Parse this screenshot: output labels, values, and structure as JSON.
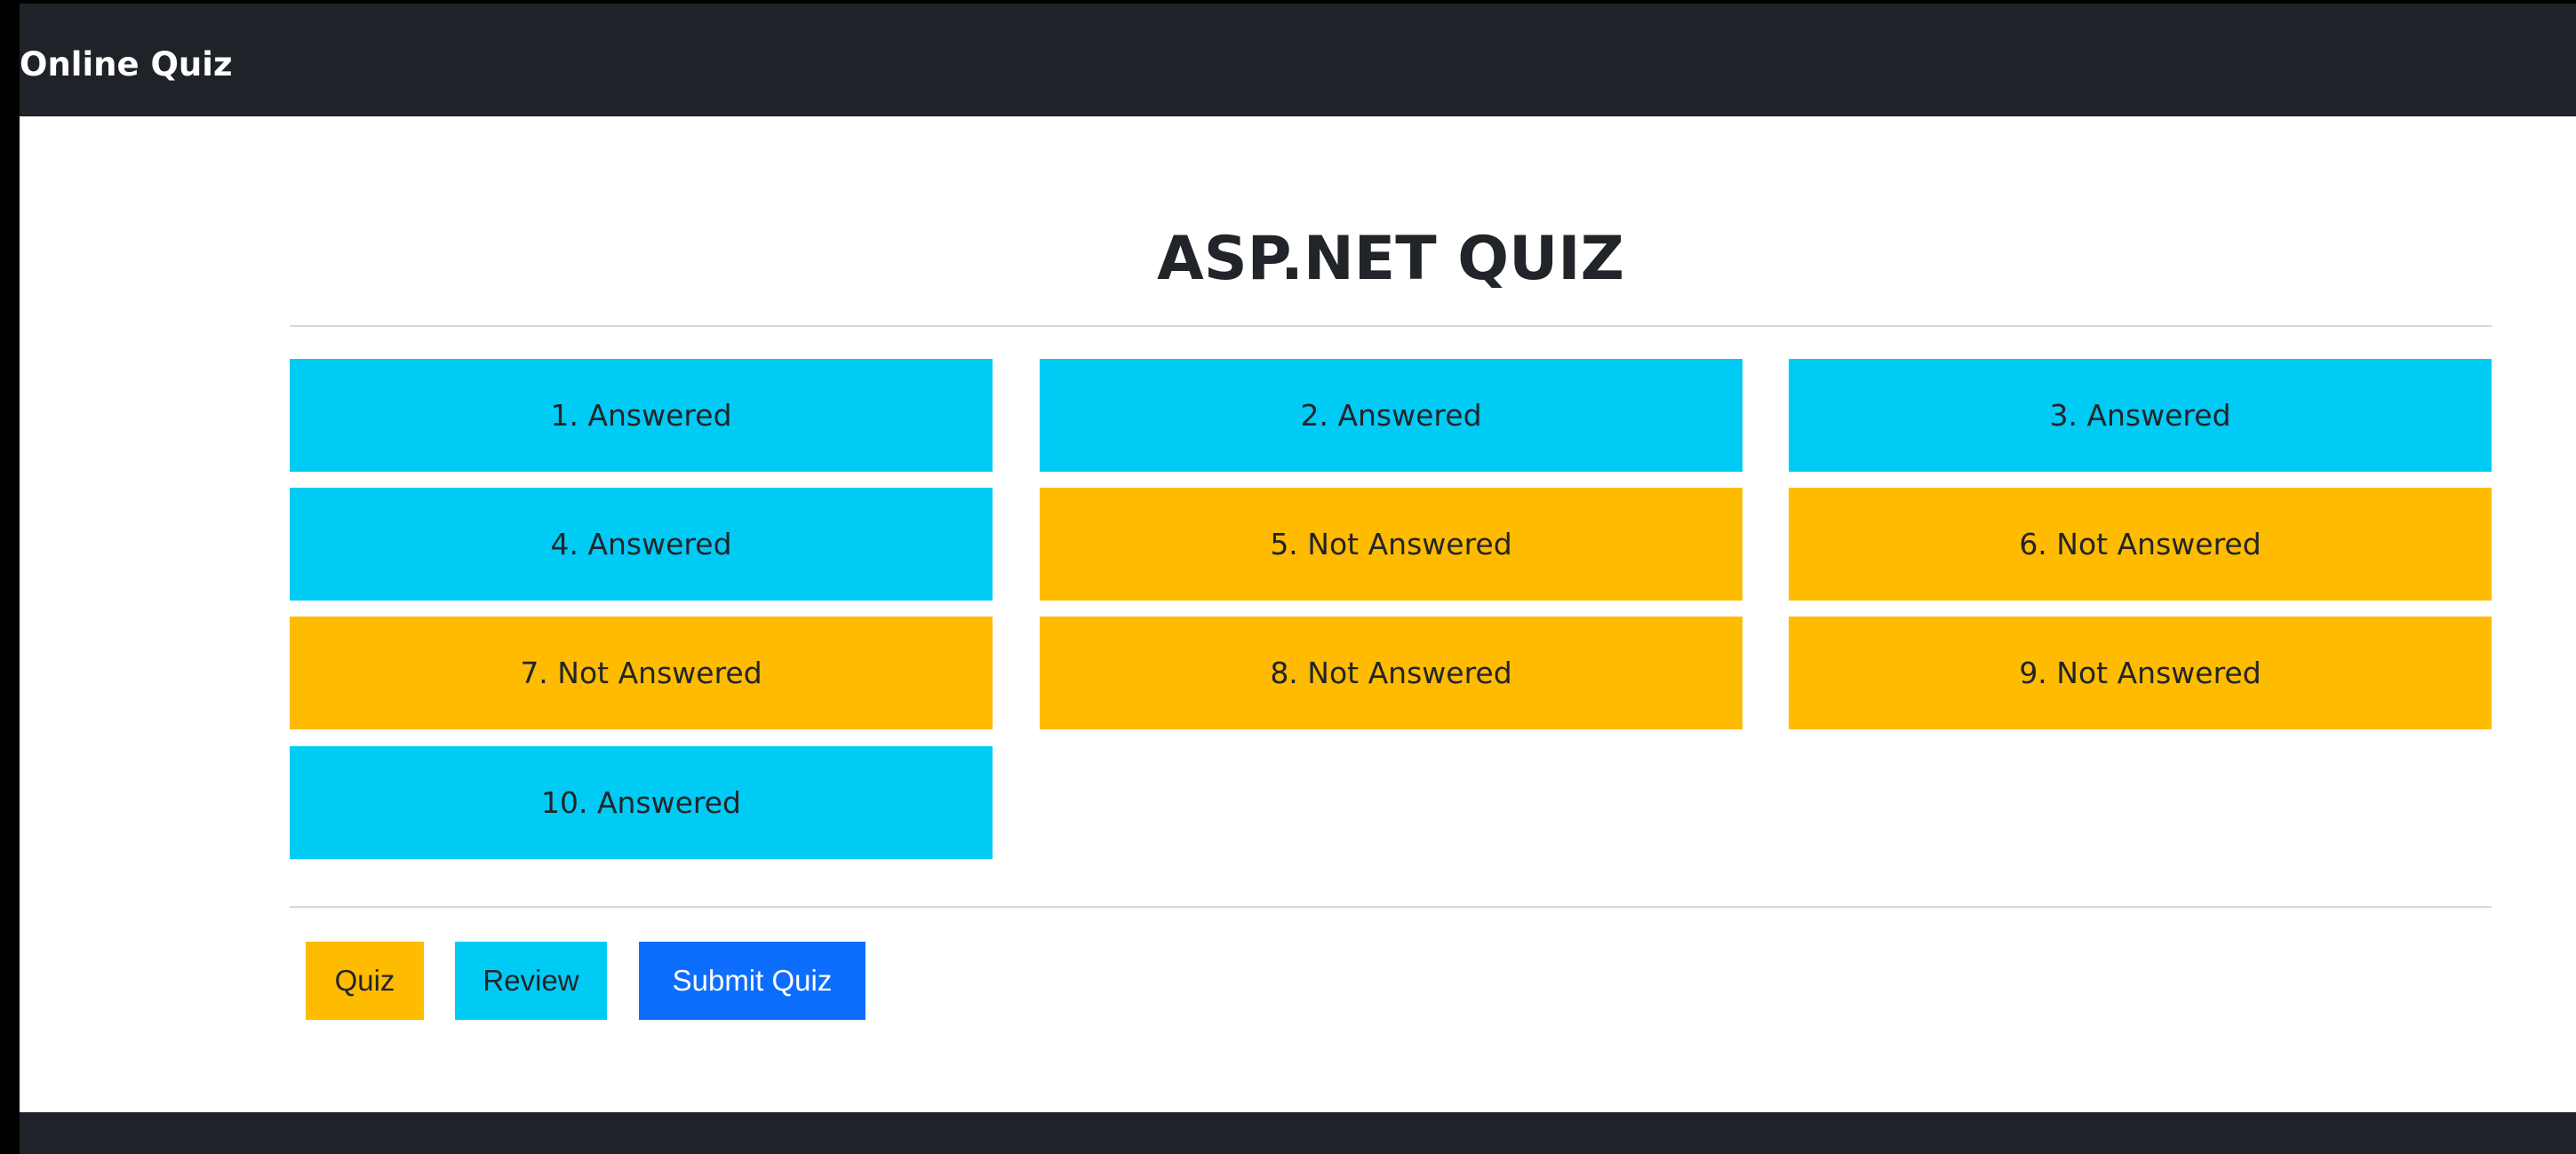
{
  "navbar": {
    "brand": "Online Quiz"
  },
  "quiz": {
    "title": "ASP.NET QUIZ",
    "questions": [
      {
        "label": "1. Answered",
        "status": "answered"
      },
      {
        "label": "2. Answered",
        "status": "answered"
      },
      {
        "label": "3. Answered",
        "status": "answered"
      },
      {
        "label": "4. Answered",
        "status": "answered"
      },
      {
        "label": "5. Not Answered",
        "status": "not-answered"
      },
      {
        "label": "6. Not Answered",
        "status": "not-answered"
      },
      {
        "label": "7. Not Answered",
        "status": "not-answered"
      },
      {
        "label": "8. Not Answered",
        "status": "not-answered"
      },
      {
        "label": "9. Not Answered",
        "status": "not-answered"
      },
      {
        "label": "10. Answered",
        "status": "answered"
      }
    ]
  },
  "actions": {
    "quiz_label": "Quiz",
    "review_label": "Review",
    "submit_label": "Submit Quiz"
  },
  "colors": {
    "navbar": "#1f2229",
    "answered": "#00cbf5",
    "not_answered": "#ffbb00",
    "submit": "#0d6efd"
  }
}
